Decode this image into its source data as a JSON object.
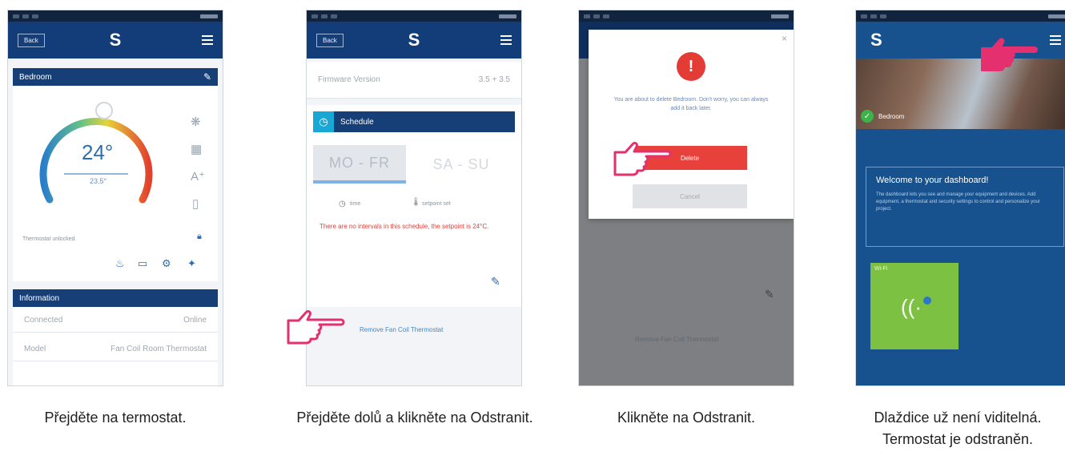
{
  "common": {
    "back_label": "Back",
    "logo_glyph": "S",
    "colors": {
      "header": "#123d78",
      "accent_red": "#e33c36",
      "tile_green": "#7cc142",
      "hand_pink": "#e4306f"
    }
  },
  "panel1": {
    "caption": "Přejděte na termostat.",
    "room_title": "Bedroom",
    "set_temp": "24°",
    "current_temp": "23.5°",
    "status_text": "Thermostat unlocked",
    "info_title": "Information",
    "rows": [
      {
        "label": "Connected",
        "value": "Online"
      },
      {
        "label": "Model",
        "value": "Fan Coil Room Thermostat"
      }
    ]
  },
  "panel2": {
    "caption": "Přejděte dolů a klikněte na Odstranit.",
    "firmware_label": "Firmware Version",
    "firmware_value": "3.5 + 3.5",
    "schedule_title": "Schedule",
    "tab_weekday": "MO - FR",
    "tab_weekend": "SA - SU",
    "legend_time": "time",
    "legend_setpoint": "setpoint set",
    "warning": "There are no intervals in this schedule, the setpoint is 24°C.",
    "remove_link": "Remove Fan Coil Thermostat"
  },
  "panel3": {
    "caption": "Klikněte na Odstranit.",
    "alert_glyph": "!",
    "message": "You are about to delete Bedroom. Don't worry, you can always add it back later.",
    "delete_label": "Delete",
    "cancel_label": "Cancel",
    "bg_link": "Remove Fan Coil Thermostat"
  },
  "panel4": {
    "caption": "Dlaždice už není viditelná. Termostat je odstraněn.",
    "room_label": "Bedroom",
    "welcome_title": "Welcome to your dashboard!",
    "welcome_text": "The dashboard lets you see and manage your equipment and devices. Add equipment, a thermostat and security settings to control and personalize your project.",
    "tile_title": "Wi-Fi"
  }
}
